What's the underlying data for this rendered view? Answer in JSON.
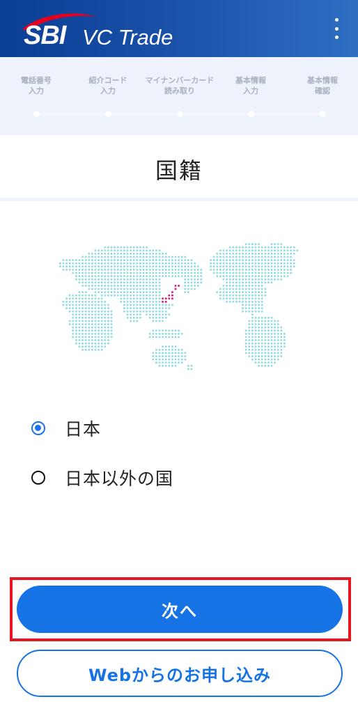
{
  "header": {
    "logo_brand": "SBI",
    "logo_product": "VC Trade",
    "menu_icon": "vertical-ellipsis-icon"
  },
  "steps": [
    {
      "line1": "電話番号",
      "line2": "入力"
    },
    {
      "line1": "紹介コード",
      "line2": "入力"
    },
    {
      "line1": "マイナンバーカード",
      "line2": "読み取り"
    },
    {
      "line1": "基本情報",
      "line2": "入力"
    },
    {
      "line1": "基本情報",
      "line2": "確認"
    }
  ],
  "page": {
    "title": "国籍"
  },
  "map": {
    "icon": "world-map-icon",
    "dot_color": "#9adbe0",
    "highlight_color": "#d6267a"
  },
  "nationality_options": [
    {
      "label": "日本",
      "checked": true
    },
    {
      "label": "日本以外の国",
      "checked": false
    }
  ],
  "buttons": {
    "next_label": "次へ",
    "web_label": "Webからのお申し込み"
  },
  "colors": {
    "header_start": "#0b3f95",
    "header_end": "#2e6fc2",
    "primary": "#1673e6",
    "highlight_border": "#e8141e",
    "steps_bg": "#eef3fb"
  }
}
